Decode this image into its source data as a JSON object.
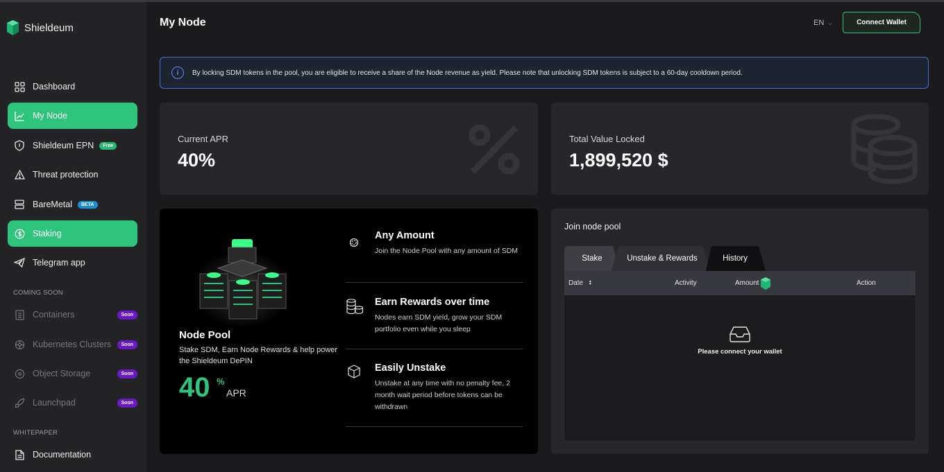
{
  "app": {
    "name": "Shieldeum"
  },
  "header": {
    "title": "My Node",
    "lang": "EN",
    "connect_label": "Connect Wallet"
  },
  "sidebar": {
    "items": [
      {
        "label": "Dashboard"
      },
      {
        "label": "My Node"
      },
      {
        "label": "Shieldeum EPN",
        "badge": "Free"
      },
      {
        "label": "Threat protection"
      },
      {
        "label": "BareMetal",
        "badge": "BETA"
      },
      {
        "label": "Staking"
      },
      {
        "label": "Telegram app"
      }
    ],
    "coming_soon_label": "COMING SOON",
    "soon_items": [
      {
        "label": "Containers",
        "badge": "Soon"
      },
      {
        "label": "Kubernetes Clusters",
        "badge": "Soon"
      },
      {
        "label": "Object Storage",
        "badge": "Soon"
      },
      {
        "label": "Launchpad",
        "badge": "Soon"
      }
    ],
    "whitepaper_label": "WHITEPAPER",
    "documentation_label": "Documentation"
  },
  "info": {
    "text": "By locking SDM tokens in the pool, you are eligible to receive a share of the Node revenue as yield. Please note that unlocking SDM tokens is subject to a 60-day cooldown period."
  },
  "stats": {
    "apr_label": "Current APR",
    "apr_value": "40%",
    "tvl_label": "Total Value Locked",
    "tvl_value": "1,899,520 $"
  },
  "pool": {
    "title": "Node Pool",
    "desc": "Stake SDM, Earn Node Rewards & help power the Shieldeum DePIN",
    "apr": "40",
    "pct": "%",
    "apr_label": "APR",
    "features": [
      {
        "title": "Any Amount",
        "desc": "Join the Node Pool with any amount of SDM"
      },
      {
        "title": "Earn Rewards over time",
        "desc": "Nodes earn SDM yield, grow your SDM portfolio even while you sleep"
      },
      {
        "title": "Easily Unstake",
        "desc": "Unstake at any time with no penalty fee, 2 month wait period before tokens can be withdrawn"
      }
    ]
  },
  "join": {
    "title": "Join node pool",
    "tabs": [
      "Stake",
      "Unstake & Rewards",
      "History"
    ],
    "columns": [
      "Date",
      "Activity",
      "Amount",
      "Action"
    ],
    "sort_indicator": "▲▼",
    "empty": "Please connect your wallet"
  },
  "colors": {
    "accent": "#2fc47c",
    "info_border": "#3e6fd6",
    "soon": "#6a18c8"
  }
}
